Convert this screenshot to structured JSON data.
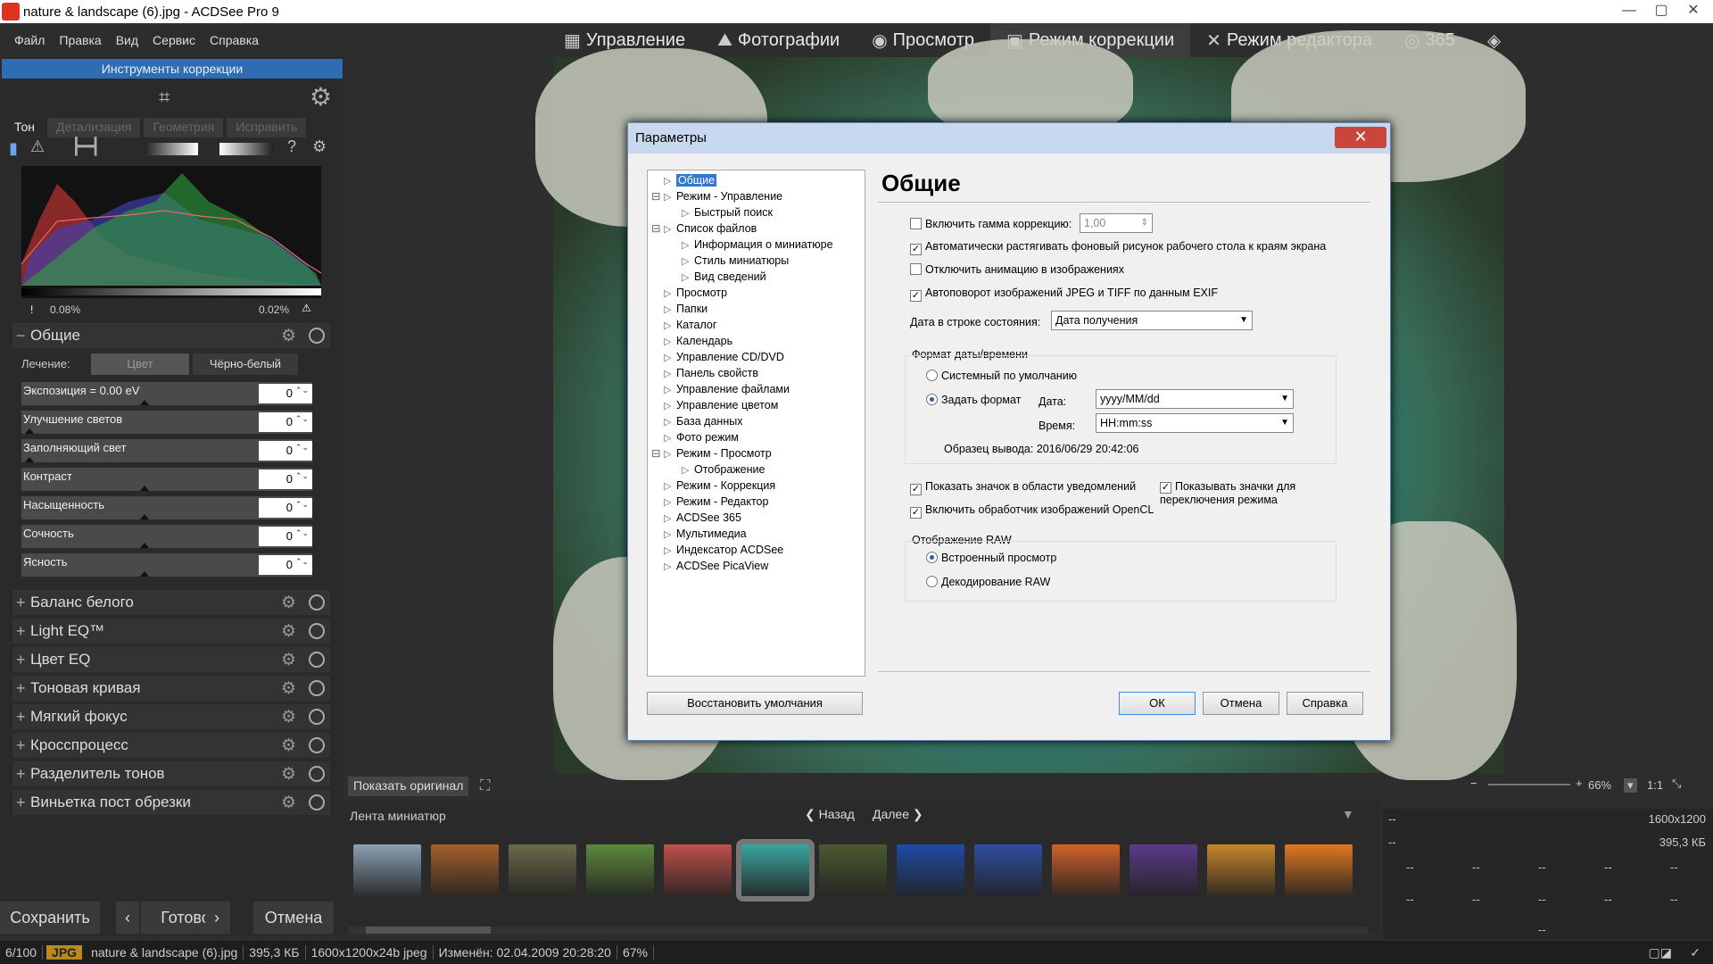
{
  "window": {
    "title": "nature & landscape (6).jpg - ACDSee Pro 9",
    "minimize": "—",
    "maximize": "▢",
    "close": "✕"
  },
  "menu": [
    "Файл",
    "Правка",
    "Вид",
    "Сервис",
    "Справка"
  ],
  "modes": [
    {
      "label": "Управление",
      "icon": "grid-icon"
    },
    {
      "label": "Фотографии",
      "icon": "photos-icon"
    },
    {
      "label": "Просмотр",
      "icon": "eye-icon"
    },
    {
      "label": "Режим коррекции",
      "icon": "develop-icon"
    },
    {
      "label": "Режим редактора",
      "icon": "edit-icon"
    },
    {
      "label": "365",
      "icon": "365-icon"
    }
  ],
  "left_panel": {
    "header": "Инструменты коррекции",
    "tabs": [
      "Тон",
      "Детализация",
      "Геометрия",
      "Исправить"
    ],
    "hist_left": "0.08%",
    "hist_right": "0.02%",
    "general": {
      "title": "Общие",
      "treatment_label": "Лечение:",
      "color_btn": "Цвет",
      "bw_btn": "Чёрно-белый",
      "sliders": [
        {
          "label": "Экспозиция = 0.00 eV",
          "value": "0",
          "level": 0.5
        },
        {
          "label": "Улучшение светов",
          "value": "0",
          "level": 0
        },
        {
          "label": "Заполняющий свет",
          "value": "0",
          "level": 0
        },
        {
          "label": "Контраст",
          "value": "0",
          "level": 0.5
        },
        {
          "label": "Насыщенность",
          "value": "0",
          "level": 0.5
        },
        {
          "label": "Сочность",
          "value": "0",
          "level": 0.5
        },
        {
          "label": "Ясность",
          "value": "0",
          "level": 0.5
        }
      ]
    },
    "sections": [
      "Баланс белого",
      "Light EQ™",
      "Цвет EQ",
      "Тоновая кривая",
      "Мягкий фокус",
      "Кросспроцесс",
      "Разделитель тонов",
      "Виньетка пост обрезки"
    ],
    "save": "Сохранить",
    "done": "Готово",
    "cancel": "Отмена"
  },
  "dialog": {
    "title": "Параметры",
    "close": "✕",
    "tree": [
      {
        "label": "Общие",
        "level": 0,
        "selected": true
      },
      {
        "label": "Режим - Управление",
        "level": 0,
        "expanded": true
      },
      {
        "label": "Быстрый поиск",
        "level": 1
      },
      {
        "label": "Список файлов",
        "level": 0,
        "expanded": true
      },
      {
        "label": "Информация о миниатюре",
        "level": 1
      },
      {
        "label": "Стиль миниатюры",
        "level": 1
      },
      {
        "label": "Вид сведений",
        "level": 1
      },
      {
        "label": "Просмотр",
        "level": 0
      },
      {
        "label": "Папки",
        "level": 0
      },
      {
        "label": "Каталог",
        "level": 0
      },
      {
        "label": "Календарь",
        "level": 0
      },
      {
        "label": "Управление CD/DVD",
        "level": 0
      },
      {
        "label": "Панель свойств",
        "level": 0
      },
      {
        "label": "Управление файлами",
        "level": 0
      },
      {
        "label": "Управление цветом",
        "level": 0
      },
      {
        "label": "База данных",
        "level": 0
      },
      {
        "label": "Фото режим",
        "level": 0
      },
      {
        "label": "Режим - Просмотр",
        "level": 0,
        "expanded": true
      },
      {
        "label": "Отображение",
        "level": 1
      },
      {
        "label": "Режим - Коррекция",
        "level": 0
      },
      {
        "label": "Режим - Редактор",
        "level": 0
      },
      {
        "label": "ACDSee 365",
        "level": 0
      },
      {
        "label": "Мультимедиа",
        "level": 0
      },
      {
        "label": "Индексатор ACDSee",
        "level": 0
      },
      {
        "label": "ACDSee PicaView",
        "level": 0
      }
    ],
    "heading": "Общие",
    "gamma_label": "Включить гамма коррекцию:",
    "gamma_value": "1,00",
    "opt_stretch": "Автоматически растягивать фоновый рисунок рабочего стола к краям экрана",
    "opt_anim": "Отключить анимацию в изображениях",
    "opt_rotate": "Автоповорот изображений JPEG и TIFF по данным EXIF",
    "status_date_label": "Дата в строке состояния:",
    "status_date_value": "Дата получения",
    "fmt_group": "Формат даты/времени",
    "fmt_system": "Системный по умолчанию",
    "fmt_custom": "Задать формат",
    "date_label": "Дата:",
    "date_value": "yyyy/MM/dd",
    "time_label": "Время:",
    "time_value": "HH:mm:ss",
    "sample": "Образец вывода: 2016/06/29 20:42:06",
    "opt_tray": "Показать значок в области уведомлений",
    "opt_opencl": "Включить обработчик изображений OpenCL",
    "opt_modes": "Показывать значки для переключения режима",
    "raw_group": "Отображение RAW",
    "raw_embedded": "Встроенный просмотр",
    "raw_decode": "Декодирование RAW",
    "restore": "Восстановить умолчания",
    "ok": "ОК",
    "cancel": "Отмена",
    "help": "Справка"
  },
  "bottom": {
    "show_original": "Показать оригинал",
    "zoom": "66%",
    "ratio": "1:1",
    "strip_title": "Лента миниатюр",
    "back": "Назад",
    "next": "Далее",
    "info": {
      "dims": "1600x1200",
      "size": "395,3 КБ",
      "dash": "--"
    }
  },
  "thumb_colors": [
    "#8ba0b3",
    "#a5602a",
    "#6a6a4a",
    "#5d8a3b",
    "#c0504a",
    "#3aa6a0",
    "#4b5a30",
    "#1f4aa8",
    "#2c4f9e",
    "#d2622a",
    "#5a3a8a",
    "#c8862a",
    "#e07820"
  ],
  "status": {
    "index": "6/100",
    "type": "JPG",
    "file": "nature & landscape (6).jpg",
    "size": "395,3 КБ",
    "dims": "1600x1200x24b jpeg",
    "modified": "Изменён: 02.04.2009 20:28:20",
    "zoom": "67%"
  }
}
